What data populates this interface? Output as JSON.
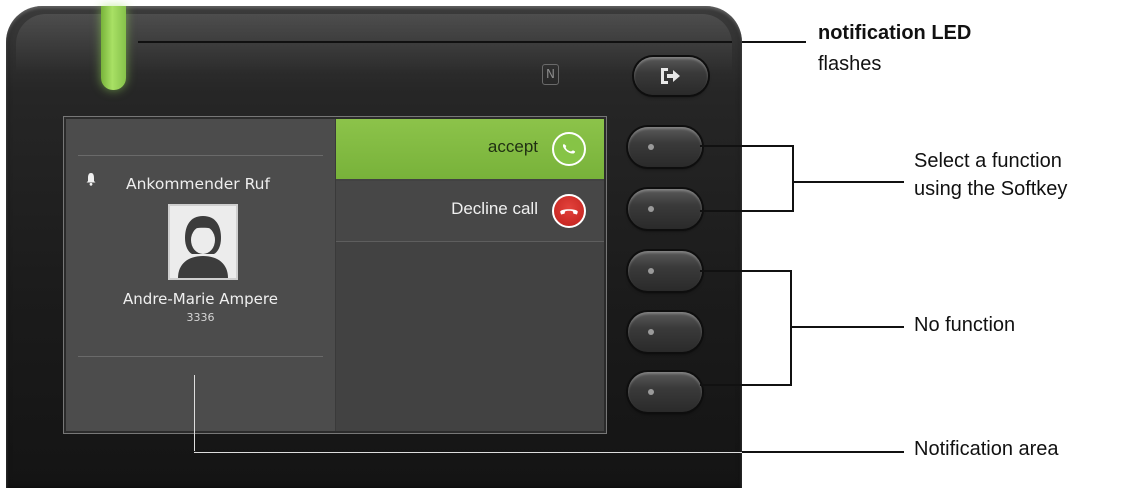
{
  "phone": {
    "logout_key_icon": "logout-arrow-icon",
    "nfc_icon": "nfc-icon",
    "led_color": "#9ad55a"
  },
  "screen": {
    "notification": {
      "icon": "bell-icon",
      "title": "Ankommender Ruf",
      "avatar_icon": "person-avatar-icon",
      "caller_name": "Andre-Marie Ampere",
      "caller_number": "3336"
    },
    "menu": [
      {
        "label": "accept",
        "icon": "phone-accept-icon",
        "color": "#7fbb42"
      },
      {
        "label": "Decline call",
        "icon": "phone-decline-icon",
        "color": "#d12f2a"
      }
    ]
  },
  "callouts": {
    "led_title": "notification LED",
    "led_sub": "flashes",
    "softkey_line1": "Select a function",
    "softkey_line2": "using the Softkey",
    "no_function": "No function",
    "notification_area": "Notification area"
  }
}
